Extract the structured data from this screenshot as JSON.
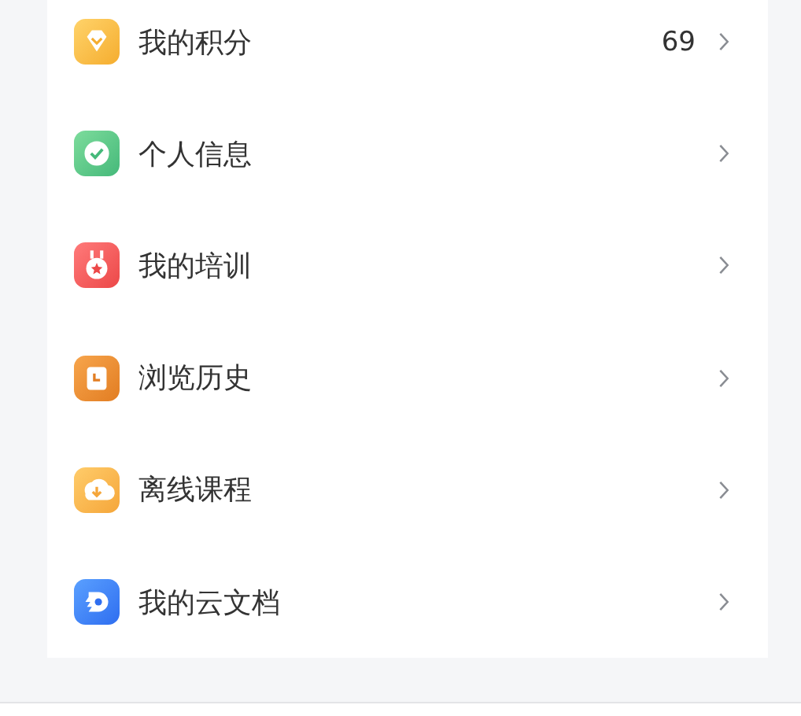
{
  "menu": [
    {
      "kind": "points",
      "label": "我的积分",
      "value": "69"
    },
    {
      "kind": "profile",
      "label": "个人信息"
    },
    {
      "kind": "training",
      "label": "我的培训"
    },
    {
      "kind": "history",
      "label": "浏览历史"
    },
    {
      "kind": "offline",
      "label": "离线课程"
    },
    {
      "kind": "clouddoc",
      "label": "我的云文档"
    }
  ]
}
